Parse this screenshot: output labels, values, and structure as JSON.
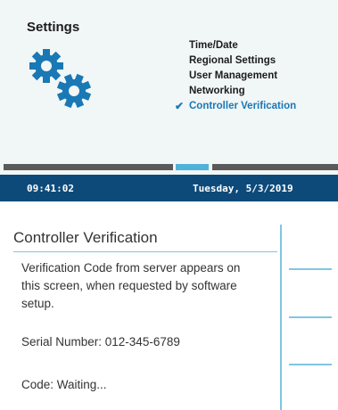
{
  "settings": {
    "title": "Settings",
    "icon": "gears-icon",
    "menu": [
      {
        "label": "Time/Date",
        "selected": false
      },
      {
        "label": "Regional Settings",
        "selected": false
      },
      {
        "label": "User Management",
        "selected": false
      },
      {
        "label": "Networking",
        "selected": false
      },
      {
        "label": "Controller Verification",
        "selected": true
      }
    ]
  },
  "status_bar": {
    "time": "09:41:02",
    "date": "Tuesday, 5/3/2019"
  },
  "verification": {
    "title": "Controller Verification",
    "description": "Verification Code from server appears on this screen, when requested by software setup.",
    "serial": "Serial Number: 012-345-6789",
    "code": "Code: Waiting..."
  },
  "colors": {
    "accent": "#1a78b5",
    "status_bar": "#0d4a7a",
    "progress_active": "#4fb3d9",
    "divider": "#7fc6e3"
  }
}
